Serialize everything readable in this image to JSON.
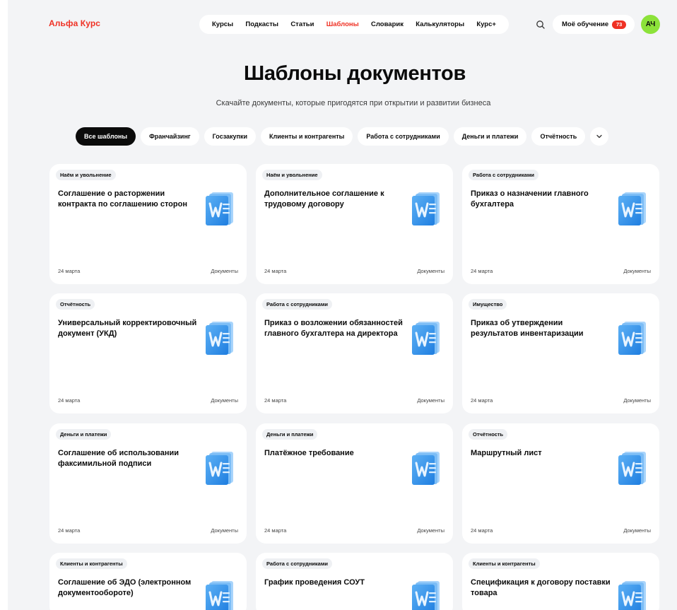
{
  "header": {
    "logo": "Альфа Курс",
    "nav": [
      "Курсы",
      "Подкасты",
      "Статьи",
      "Шаблоны",
      "Словарик",
      "Калькуляторы",
      "Курс+"
    ],
    "my_learning": "Моё обучение",
    "notifications_count": "73",
    "avatar_initials": "АЧ"
  },
  "hero": {
    "title": "Шаблоны документов",
    "subtitle": "Скачайте документы, которые пригодятся при открытии и развитии бизнеса"
  },
  "filters": [
    "Все шаблоны",
    "Франчайзинг",
    "Госзакупки",
    "Клиенты и контрагенты",
    "Работа с сотрудниками",
    "Деньги и платежи",
    "Отчётность"
  ],
  "cards": [
    {
      "tag": "Наём и увольнение",
      "title": "Соглашение о расторжении контракта по соглашению сторон",
      "date": "24 марта",
      "type": "Документы"
    },
    {
      "tag": "Наём и увольнение",
      "title": "Дополнительное соглашение к трудовому договору",
      "date": "24 марта",
      "type": "Документы"
    },
    {
      "tag": "Работа с сотрудниками",
      "title": "Приказ о назначении главного бухгалтера",
      "date": "24 марта",
      "type": "Документы"
    },
    {
      "tag": "Отчётность",
      "title": "Универсальный корректировочный документ (УКД)",
      "date": "24 марта",
      "type": "Документы"
    },
    {
      "tag": "Работа с сотрудниками",
      "title": "Приказ о возложении обязанностей главного бухгалтера на директора",
      "date": "24 марта",
      "type": "Документы"
    },
    {
      "tag": "Имущество",
      "title": "Приказ об утверждении результатов инвентаризации",
      "date": "24 марта",
      "type": "Документы"
    },
    {
      "tag": "Деньги и платежи",
      "title": "Соглашение об использовании факсимильной подписи",
      "date": "24 марта",
      "type": "Документы"
    },
    {
      "tag": "Деньги и платежи",
      "title": "Платёжное требование",
      "date": "24 марта",
      "type": "Документы"
    },
    {
      "tag": "Отчётность",
      "title": "Маршрутный лист",
      "date": "24 марта",
      "type": "Документы"
    },
    {
      "tag": "Клиенты и контрагенты",
      "title": "Соглашение об ЭДО (электронном документообороте)",
      "date": "",
      "type": ""
    },
    {
      "tag": "Работа с сотрудниками",
      "title": "График проведения СОУТ",
      "date": "",
      "type": ""
    },
    {
      "tag": "Клиенты и контрагенты",
      "title": "Спецификация к договору поставки товара",
      "date": "",
      "type": ""
    }
  ],
  "icon_name": "word-document-icon",
  "colors": {
    "accent": "#ef3124",
    "avatar": "#8ce23a",
    "icon_blue": "#2f8be6"
  }
}
